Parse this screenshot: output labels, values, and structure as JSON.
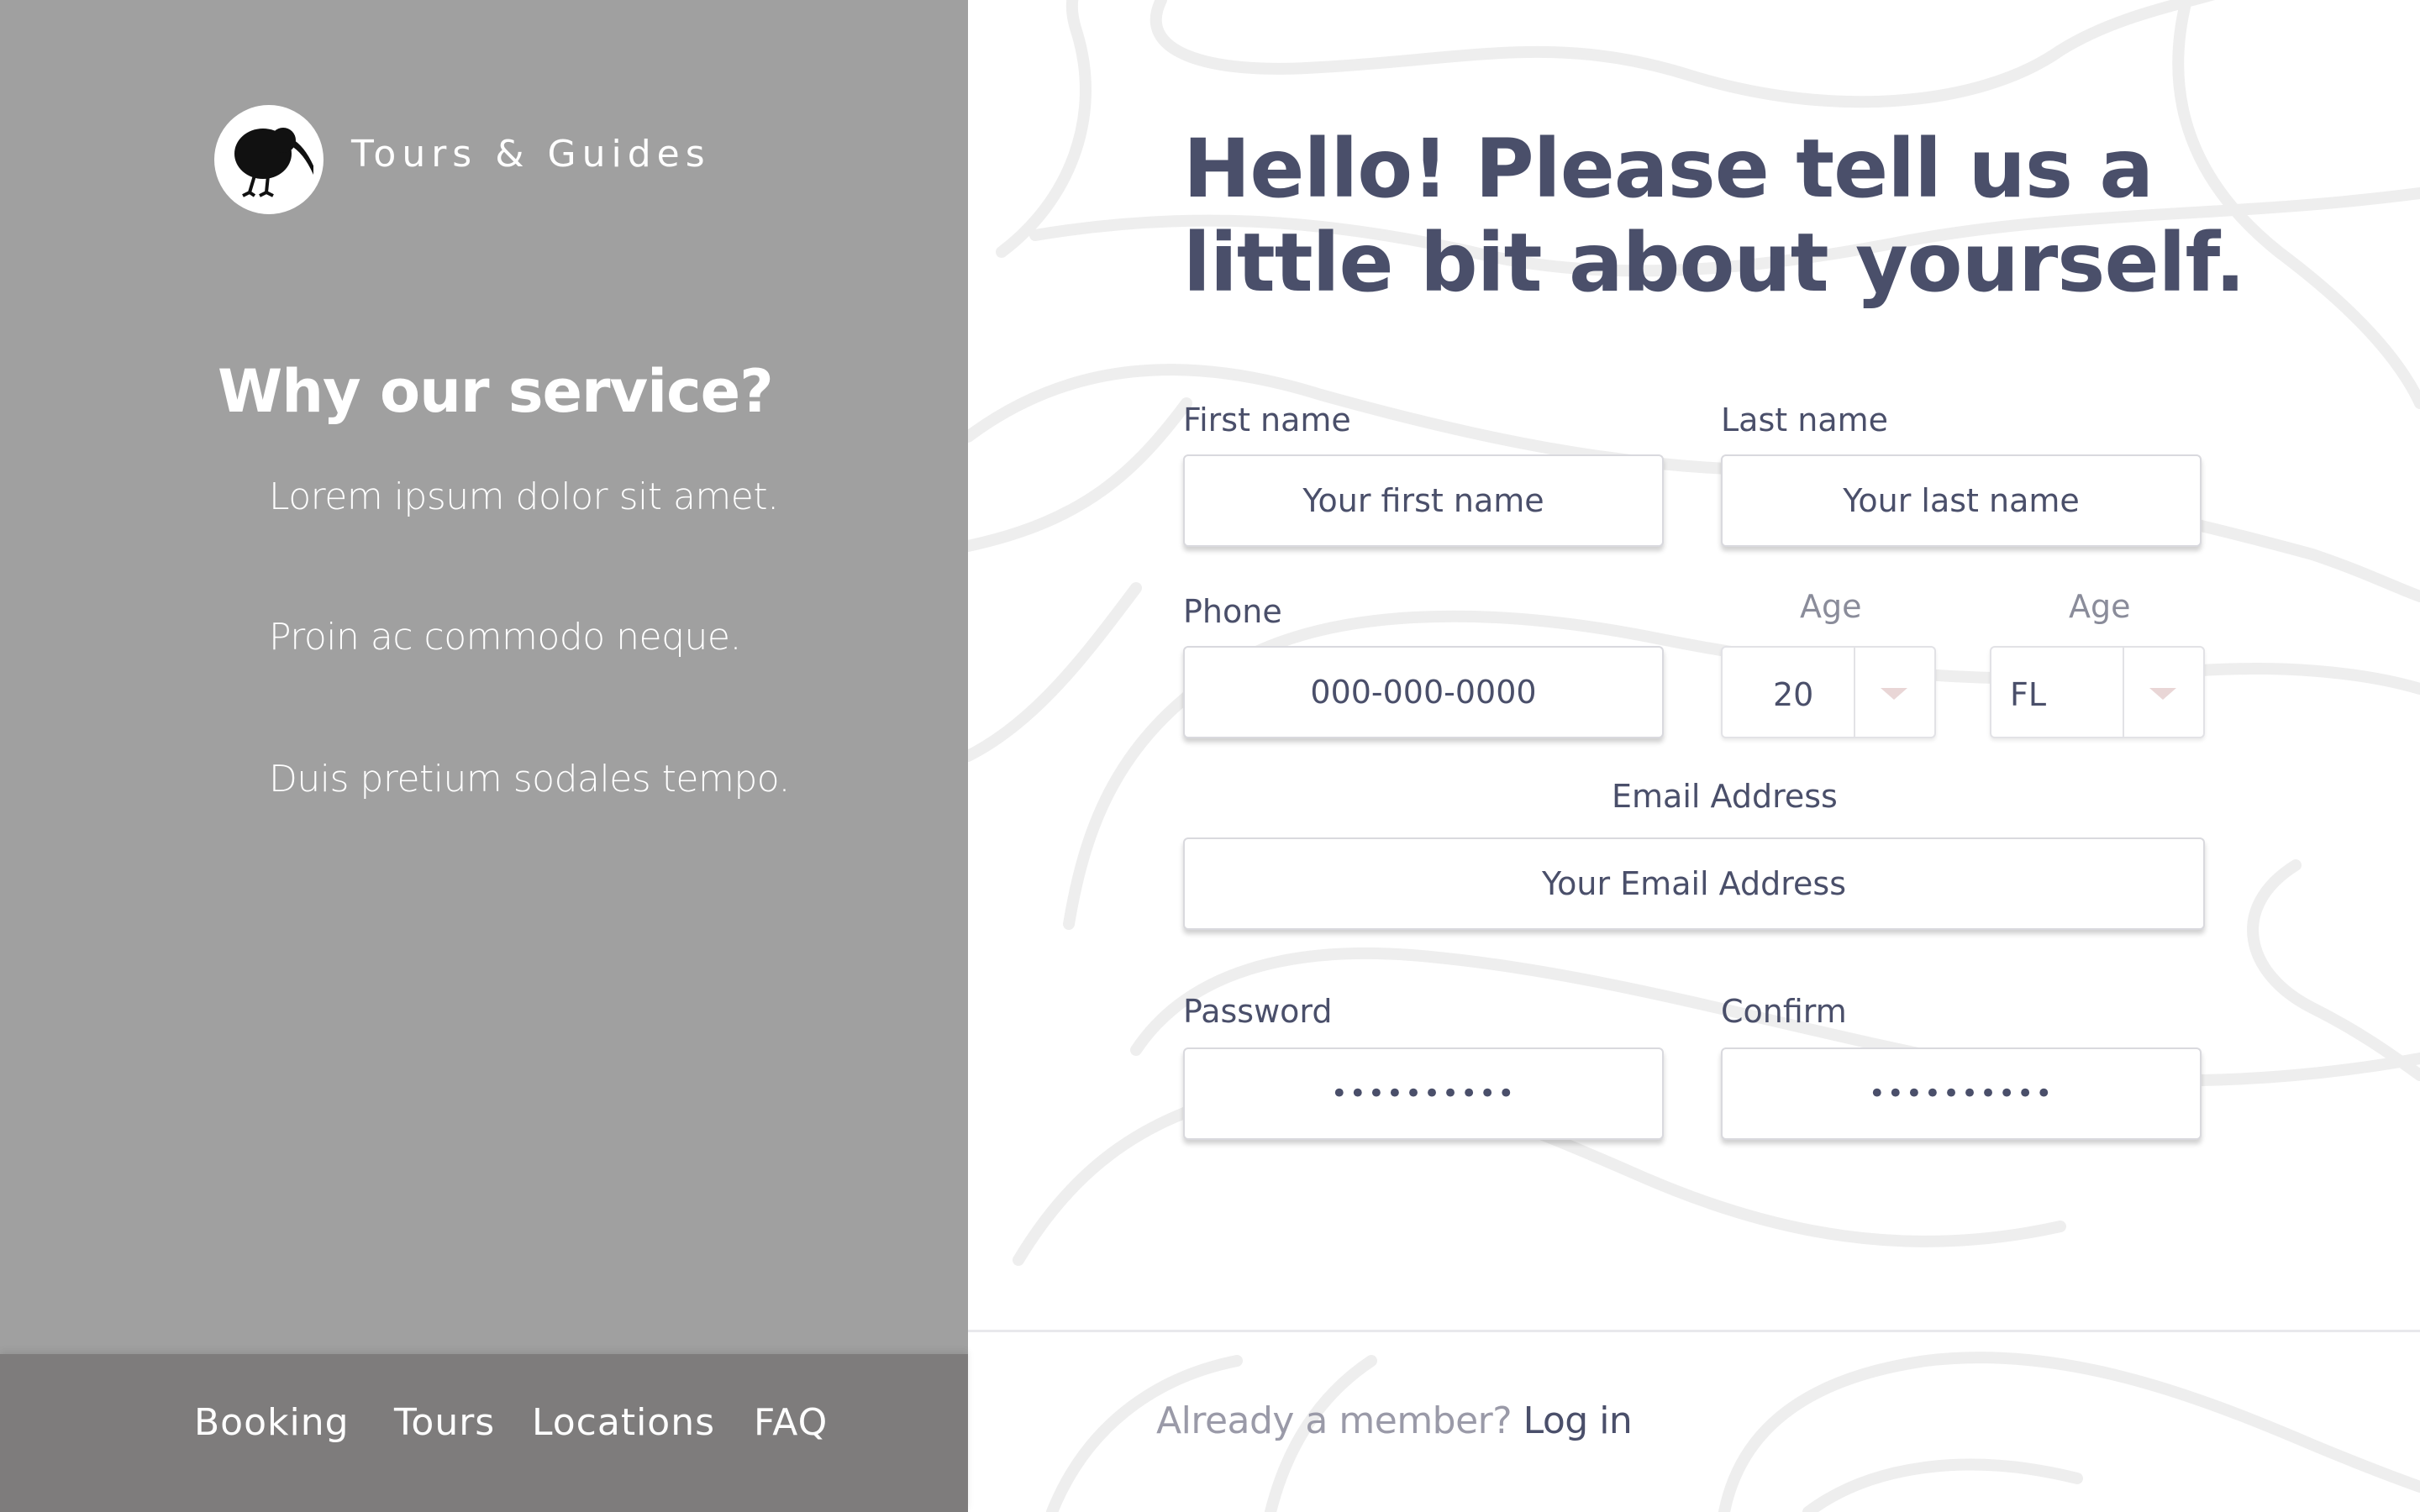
{
  "brand": {
    "name": "Tours & Guides",
    "logo_icon": "kiwi-bird-icon"
  },
  "sidebar": {
    "title": "Why our service?",
    "points": [
      "Lorem ipsum dolor sit amet.",
      "Proin ac commodo neque.",
      "Duis pretium sodales tempo."
    ]
  },
  "nav": {
    "items": [
      "Booking",
      "Tours",
      "Locations",
      "FAQ"
    ]
  },
  "form": {
    "headline": "Hello! Please tell us a little bit about yourself.",
    "first_name": {
      "label": "First name",
      "placeholder": "Your first name"
    },
    "last_name": {
      "label": "Last name",
      "placeholder": "Your last name"
    },
    "phone": {
      "label": "Phone",
      "placeholder": "000-000-0000"
    },
    "age": {
      "label": "Age",
      "value": "20"
    },
    "state": {
      "label": "Age",
      "value": "FL"
    },
    "email": {
      "label": "Email Address",
      "placeholder": "Your Email Address"
    },
    "password": {
      "label": "Password",
      "value": "••••••••••"
    },
    "confirm": {
      "label": "Confirm",
      "value": "••••••••••"
    }
  },
  "footer": {
    "question": "Already a member?",
    "login": "Log in"
  },
  "colors": {
    "sidebar_bg": "#a0a0a0",
    "nav_bg": "#7e7c7c",
    "text_dark": "#4a4f6a",
    "text_muted": "#9a9aa8",
    "caret": "#e9d6d6"
  }
}
